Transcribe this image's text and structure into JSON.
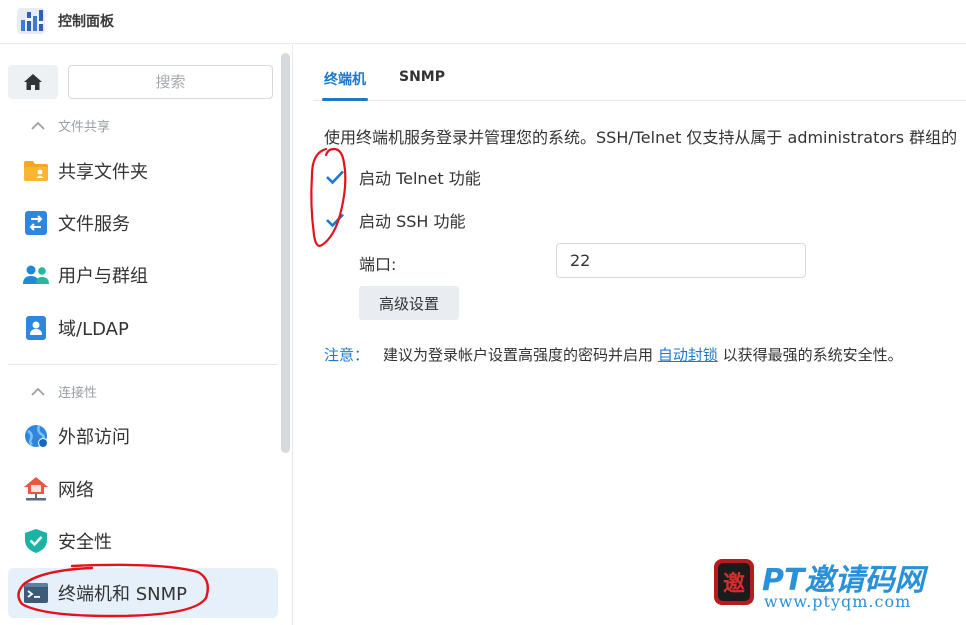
{
  "window": {
    "title": "控制面板"
  },
  "sidebar": {
    "search_placeholder": "搜索",
    "sections": [
      {
        "label": "文件共享"
      },
      {
        "label": "连接性"
      }
    ],
    "items": [
      {
        "label": "共享文件夹",
        "icon": "shared-folder-icon"
      },
      {
        "label": "文件服务",
        "icon": "file-services-icon"
      },
      {
        "label": "用户与群组",
        "icon": "user-group-icon"
      },
      {
        "label": "域/LDAP",
        "icon": "domain-ldap-icon"
      },
      {
        "label": "外部访问",
        "icon": "external-access-icon"
      },
      {
        "label": "网络",
        "icon": "network-icon"
      },
      {
        "label": "安全性",
        "icon": "security-shield-icon"
      },
      {
        "label": "终端机和 SNMP",
        "icon": "terminal-icon",
        "active": true
      }
    ]
  },
  "tabs": [
    {
      "label": "终端机",
      "active": true
    },
    {
      "label": "SNMP",
      "active": false
    }
  ],
  "terminal": {
    "description": "使用终端机服务登录并管理您的系统。SSH/Telnet 仅支持从属于 administrators 群组的",
    "telnet_label": "启动 Telnet 功能",
    "telnet_checked": true,
    "ssh_label": "启动 SSH 功能",
    "ssh_checked": true,
    "port_label": "端口:",
    "port_value": "22",
    "advanced_button": "高级设置",
    "note_label": "注意：",
    "note_text_before": "建议为登录帐户设置高强度的密码并启用",
    "note_link": "自动封锁",
    "note_text_after": "以获得最强的系统安全性。"
  },
  "watermark": {
    "title": "PT邀请码网",
    "url": "www.ptyqm.com",
    "seal_text": "邀"
  },
  "colors": {
    "accent": "#1c79c9",
    "active_item_bg": "#e6f0fb",
    "annotation_red": "#e3121b"
  }
}
